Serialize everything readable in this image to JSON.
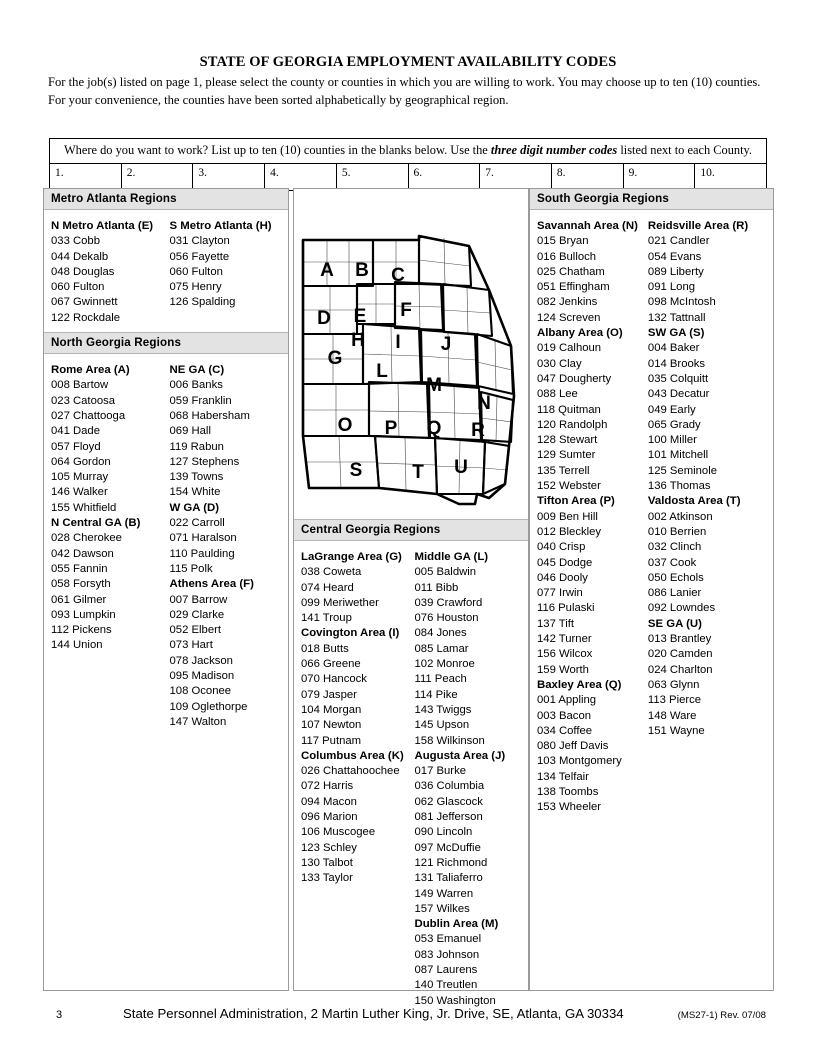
{
  "header": {
    "title": "STATE OF GEORGIA EMPLOYMENT AVAILABILITY CODES",
    "intro_line1": "For the job(s) listed on page 1, please select the county or counties in which you are willing to work.  You may choose up to ten (10) counties.  For",
    "intro_line2": "your convenience, the counties have been sorted alphabetically by geographical region."
  },
  "blanks": {
    "prompt_pre": "Where do you want to work?  List up to ten (10) counties in the blanks below.  Use the ",
    "prompt_em": "three digit number codes",
    "prompt_post": " listed next to each County.",
    "numbers": [
      "1.",
      "2.",
      "3.",
      "4.",
      "5.",
      "6.",
      "7.",
      "8.",
      "9.",
      "10."
    ]
  },
  "sections": {
    "metro": {
      "heading": "Metro Atlanta Regions",
      "left": [
        {
          "type": "title",
          "text": "N Metro Atlanta (E)"
        },
        {
          "type": "county",
          "code": "033",
          "name": "Cobb"
        },
        {
          "type": "county",
          "code": "044",
          "name": "Dekalb"
        },
        {
          "type": "county",
          "code": "048",
          "name": "Douglas"
        },
        {
          "type": "county",
          "code": "060",
          "name": "Fulton"
        },
        {
          "type": "county",
          "code": "067",
          "name": "Gwinnett"
        },
        {
          "type": "county",
          "code": "122",
          "name": "Rockdale"
        }
      ],
      "right": [
        {
          "type": "title",
          "text": "S Metro Atlanta (H)"
        },
        {
          "type": "county",
          "code": "031",
          "name": "Clayton"
        },
        {
          "type": "county",
          "code": "056",
          "name": "Fayette"
        },
        {
          "type": "county",
          "code": "060",
          "name": "Fulton"
        },
        {
          "type": "county",
          "code": "075",
          "name": "Henry"
        },
        {
          "type": "county",
          "code": "126",
          "name": "Spalding"
        }
      ]
    },
    "north": {
      "heading": "North Georgia Regions",
      "left": [
        {
          "type": "title",
          "text": "Rome Area (A)"
        },
        {
          "type": "county",
          "code": "008",
          "name": "Bartow"
        },
        {
          "type": "county",
          "code": "023",
          "name": "Catoosa"
        },
        {
          "type": "county",
          "code": "027",
          "name": "Chattooga"
        },
        {
          "type": "county",
          "code": "041",
          "name": "Dade"
        },
        {
          "type": "county",
          "code": "057",
          "name": "Floyd"
        },
        {
          "type": "county",
          "code": "064",
          "name": "Gordon"
        },
        {
          "type": "county",
          "code": "105",
          "name": "Murray"
        },
        {
          "type": "county",
          "code": "146",
          "name": "Walker"
        },
        {
          "type": "county",
          "code": "155",
          "name": "Whitfield"
        },
        {
          "type": "title",
          "text": "N Central GA (B)"
        },
        {
          "type": "county",
          "code": "028",
          "name": "Cherokee"
        },
        {
          "type": "county",
          "code": "042",
          "name": "Dawson"
        },
        {
          "type": "county",
          "code": "055",
          "name": "Fannin"
        },
        {
          "type": "county",
          "code": "058",
          "name": "Forsyth"
        },
        {
          "type": "county",
          "code": "061",
          "name": "Gilmer"
        },
        {
          "type": "county",
          "code": "093",
          "name": "Lumpkin"
        },
        {
          "type": "county",
          "code": "112",
          "name": "Pickens"
        },
        {
          "type": "county",
          "code": "144",
          "name": "Union"
        }
      ],
      "right": [
        {
          "type": "title",
          "text": "NE GA (C)"
        },
        {
          "type": "county",
          "code": "006",
          "name": "Banks"
        },
        {
          "type": "county",
          "code": "059",
          "name": "Franklin"
        },
        {
          "type": "county",
          "code": "068",
          "name": "Habersham"
        },
        {
          "type": "county",
          "code": "069",
          "name": "Hall"
        },
        {
          "type": "county",
          "code": "119",
          "name": "Rabun"
        },
        {
          "type": "county",
          "code": "127",
          "name": "Stephens"
        },
        {
          "type": "county",
          "code": "139",
          "name": "Towns"
        },
        {
          "type": "county",
          "code": "154",
          "name": "White"
        },
        {
          "type": "title",
          "text": "W GA (D)"
        },
        {
          "type": "county",
          "code": "022",
          "name": "Carroll"
        },
        {
          "type": "county",
          "code": "071",
          "name": "Haralson"
        },
        {
          "type": "county",
          "code": "110",
          "name": "Paulding"
        },
        {
          "type": "county",
          "code": "115",
          "name": "Polk"
        },
        {
          "type": "title",
          "text": "Athens Area (F)"
        },
        {
          "type": "county",
          "code": "007",
          "name": "Barrow"
        },
        {
          "type": "county",
          "code": "029",
          "name": "Clarke"
        },
        {
          "type": "county",
          "code": "052",
          "name": "Elbert"
        },
        {
          "type": "county",
          "code": "073",
          "name": "Hart"
        },
        {
          "type": "county",
          "code": "078",
          "name": "Jackson"
        },
        {
          "type": "county",
          "code": "095",
          "name": "Madison"
        },
        {
          "type": "county",
          "code": "108",
          "name": "Oconee"
        },
        {
          "type": "county",
          "code": "109",
          "name": "Oglethorpe"
        },
        {
          "type": "county",
          "code": "147",
          "name": "Walton"
        }
      ]
    },
    "central": {
      "heading": "Central Georgia Regions",
      "left": [
        {
          "type": "title",
          "text": "LaGrange Area (G)"
        },
        {
          "type": "county",
          "code": "038",
          "name": "Coweta"
        },
        {
          "type": "county",
          "code": "074",
          "name": "Heard"
        },
        {
          "type": "county",
          "code": "099",
          "name": "Meriwether"
        },
        {
          "type": "county",
          "code": "141",
          "name": "Troup"
        },
        {
          "type": "title",
          "text": "Covington Area (I)"
        },
        {
          "type": "county",
          "code": "018",
          "name": "Butts"
        },
        {
          "type": "county",
          "code": "066",
          "name": "Greene"
        },
        {
          "type": "county",
          "code": "070",
          "name": "Hancock"
        },
        {
          "type": "county",
          "code": "079",
          "name": "Jasper"
        },
        {
          "type": "county",
          "code": "104",
          "name": "Morgan"
        },
        {
          "type": "county",
          "code": "107",
          "name": "Newton"
        },
        {
          "type": "county",
          "code": "117",
          "name": "Putnam"
        },
        {
          "type": "title",
          "text": "Columbus Area (K)"
        },
        {
          "type": "county",
          "code": "026",
          "name": "Chattahoochee"
        },
        {
          "type": "county",
          "code": "072",
          "name": "Harris"
        },
        {
          "type": "county",
          "code": "094",
          "name": "Macon"
        },
        {
          "type": "county",
          "code": "096",
          "name": "Marion"
        },
        {
          "type": "county",
          "code": "106",
          "name": "Muscogee"
        },
        {
          "type": "county",
          "code": "123",
          "name": "Schley"
        },
        {
          "type": "county",
          "code": "130",
          "name": "Talbot"
        },
        {
          "type": "county",
          "code": "133",
          "name": "Taylor"
        }
      ],
      "right": [
        {
          "type": "title",
          "text": "Middle GA (L)"
        },
        {
          "type": "county",
          "code": "005",
          "name": "Baldwin"
        },
        {
          "type": "county",
          "code": "011",
          "name": "Bibb"
        },
        {
          "type": "county",
          "code": "039",
          "name": "Crawford"
        },
        {
          "type": "county",
          "code": "076",
          "name": "Houston"
        },
        {
          "type": "county",
          "code": "084",
          "name": "Jones"
        },
        {
          "type": "county",
          "code": "085",
          "name": "Lamar"
        },
        {
          "type": "county",
          "code": "102",
          "name": "Monroe"
        },
        {
          "type": "county",
          "code": "111",
          "name": "Peach"
        },
        {
          "type": "county",
          "code": "114",
          "name": "Pike"
        },
        {
          "type": "county",
          "code": "143",
          "name": "Twiggs"
        },
        {
          "type": "county",
          "code": "145",
          "name": "Upson"
        },
        {
          "type": "county",
          "code": "158",
          "name": "Wilkinson"
        },
        {
          "type": "title",
          "text": "Augusta Area (J)"
        },
        {
          "type": "county",
          "code": "017",
          "name": "Burke"
        },
        {
          "type": "county",
          "code": "036",
          "name": "Columbia"
        },
        {
          "type": "county",
          "code": "062",
          "name": "Glascock"
        },
        {
          "type": "county",
          "code": "081",
          "name": "Jefferson"
        },
        {
          "type": "county",
          "code": "090",
          "name": "Lincoln"
        },
        {
          "type": "county",
          "code": "097",
          "name": "McDuffie"
        },
        {
          "type": "county",
          "code": "121",
          "name": "Richmond"
        },
        {
          "type": "county",
          "code": "131",
          "name": "Taliaferro"
        },
        {
          "type": "county",
          "code": "149",
          "name": "Warren"
        },
        {
          "type": "county",
          "code": "157",
          "name": "Wilkes"
        },
        {
          "type": "title",
          "text": "Dublin Area (M)"
        },
        {
          "type": "county",
          "code": "053",
          "name": "Emanuel"
        },
        {
          "type": "county",
          "code": "083",
          "name": "Johnson"
        },
        {
          "type": "county",
          "code": "087",
          "name": "Laurens"
        },
        {
          "type": "county",
          "code": "140",
          "name": "Treutlen"
        },
        {
          "type": "county",
          "code": "150",
          "name": "Washington"
        }
      ]
    },
    "south": {
      "heading": "South Georgia Regions",
      "left": [
        {
          "type": "title",
          "text": "Savannah Area (N)"
        },
        {
          "type": "county",
          "code": "015",
          "name": "Bryan"
        },
        {
          "type": "county",
          "code": "016",
          "name": "Bulloch"
        },
        {
          "type": "county",
          "code": "025",
          "name": "Chatham"
        },
        {
          "type": "county",
          "code": "051",
          "name": "Effingham"
        },
        {
          "type": "county",
          "code": "082",
          "name": "Jenkins"
        },
        {
          "type": "county",
          "code": "124",
          "name": "Screven"
        },
        {
          "type": "title",
          "text": "Albany Area (O)"
        },
        {
          "type": "county",
          "code": "019",
          "name": "Calhoun"
        },
        {
          "type": "county",
          "code": "030",
          "name": "Clay"
        },
        {
          "type": "county",
          "code": "047",
          "name": "Dougherty"
        },
        {
          "type": "county",
          "code": "088",
          "name": "Lee"
        },
        {
          "type": "county",
          "code": "118",
          "name": "Quitman"
        },
        {
          "type": "county",
          "code": "120",
          "name": "Randolph"
        },
        {
          "type": "county",
          "code": "128",
          "name": "Stewart"
        },
        {
          "type": "county",
          "code": "129",
          "name": "Sumter"
        },
        {
          "type": "county",
          "code": "135",
          "name": "Terrell"
        },
        {
          "type": "county",
          "code": "152",
          "name": "Webster"
        },
        {
          "type": "title",
          "text": "Tifton Area (P)"
        },
        {
          "type": "county",
          "code": "009",
          "name": "Ben Hill"
        },
        {
          "type": "county",
          "code": "012",
          "name": "Bleckley"
        },
        {
          "type": "county",
          "code": "040",
          "name": "Crisp"
        },
        {
          "type": "county",
          "code": "045",
          "name": "Dodge"
        },
        {
          "type": "county",
          "code": "046",
          "name": "Dooly"
        },
        {
          "type": "county",
          "code": "077",
          "name": "Irwin"
        },
        {
          "type": "county",
          "code": "116",
          "name": "Pulaski"
        },
        {
          "type": "county",
          "code": "137",
          "name": "Tift"
        },
        {
          "type": "county",
          "code": "142",
          "name": "Turner"
        },
        {
          "type": "county",
          "code": "156",
          "name": "Wilcox"
        },
        {
          "type": "county",
          "code": "159",
          "name": "Worth"
        },
        {
          "type": "title",
          "text": "Baxley Area (Q)"
        },
        {
          "type": "county",
          "code": "001",
          "name": "Appling"
        },
        {
          "type": "county",
          "code": "003",
          "name": "Bacon"
        },
        {
          "type": "county",
          "code": "034",
          "name": "Coffee"
        },
        {
          "type": "county",
          "code": "080",
          "name": "Jeff Davis"
        },
        {
          "type": "county",
          "code": "103",
          "name": "Montgomery"
        },
        {
          "type": "county",
          "code": "134",
          "name": "Telfair"
        },
        {
          "type": "county",
          "code": "138",
          "name": "Toombs"
        },
        {
          "type": "county",
          "code": "153",
          "name": "Wheeler"
        }
      ],
      "right": [
        {
          "type": "title",
          "text": "Reidsville Area (R)"
        },
        {
          "type": "county",
          "code": "021",
          "name": "Candler"
        },
        {
          "type": "county",
          "code": "054",
          "name": "Evans"
        },
        {
          "type": "county",
          "code": "089",
          "name": "Liberty"
        },
        {
          "type": "county",
          "code": "091",
          "name": "Long"
        },
        {
          "type": "county",
          "code": "098",
          "name": "McIntosh"
        },
        {
          "type": "county",
          "code": "132",
          "name": "Tattnall"
        },
        {
          "type": "title",
          "text": "SW GA (S)"
        },
        {
          "type": "county",
          "code": "004",
          "name": "Baker"
        },
        {
          "type": "county",
          "code": "014",
          "name": "Brooks"
        },
        {
          "type": "county",
          "code": "035",
          "name": "Colquitt"
        },
        {
          "type": "county",
          "code": "043",
          "name": "Decatur"
        },
        {
          "type": "county",
          "code": "049",
          "name": "Early"
        },
        {
          "type": "county",
          "code": "065",
          "name": "Grady"
        },
        {
          "type": "county",
          "code": "100",
          "name": "Miller"
        },
        {
          "type": "county",
          "code": "101",
          "name": "Mitchell"
        },
        {
          "type": "county",
          "code": "125",
          "name": "Seminole"
        },
        {
          "type": "county",
          "code": "136",
          "name": "Thomas"
        },
        {
          "type": "title",
          "text": "Valdosta Area (T)"
        },
        {
          "type": "county",
          "code": "002",
          "name": "Atkinson"
        },
        {
          "type": "county",
          "code": "010",
          "name": "Berrien"
        },
        {
          "type": "county",
          "code": "032",
          "name": "Clinch"
        },
        {
          "type": "county",
          "code": "037",
          "name": "Cook"
        },
        {
          "type": "county",
          "code": "050",
          "name": "Echols"
        },
        {
          "type": "county",
          "code": "086",
          "name": "Lanier"
        },
        {
          "type": "county",
          "code": "092",
          "name": "Lowndes"
        },
        {
          "type": "title",
          "text": "SE GA (U)"
        },
        {
          "type": "county",
          "code": "013",
          "name": "Brantley"
        },
        {
          "type": "county",
          "code": "020",
          "name": "Camden"
        },
        {
          "type": "county",
          "code": "024",
          "name": "Charlton"
        },
        {
          "type": "county",
          "code": "063",
          "name": "Glynn"
        },
        {
          "type": "county",
          "code": "113",
          "name": "Pierce"
        },
        {
          "type": "county",
          "code": "148",
          "name": "Ware"
        },
        {
          "type": "county",
          "code": "151",
          "name": "Wayne"
        }
      ]
    }
  },
  "map": {
    "alt": "Map of Georgia divided into lettered employment regions",
    "region_labels": [
      "A",
      "B",
      "C",
      "D",
      "E",
      "F",
      "G",
      "H",
      "I",
      "J",
      "L",
      "M",
      "N",
      "O",
      "P",
      "Q",
      "R",
      "S",
      "T",
      "U"
    ]
  },
  "footer": {
    "page_number": "3",
    "address": "State Personnel Administration, 2 Martin Luther King, Jr. Drive, SE, Atlanta, GA  30334",
    "revision": "(MS27-1) Rev. 07/08"
  }
}
